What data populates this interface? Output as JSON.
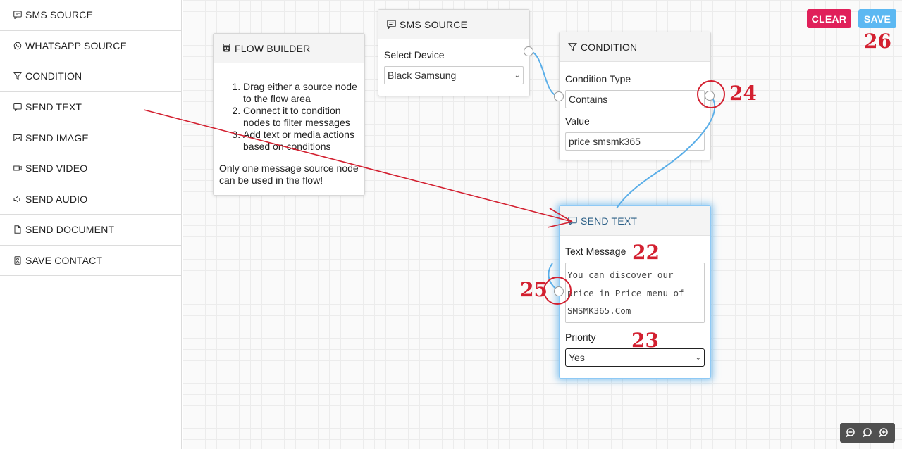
{
  "sidebar": {
    "items": [
      {
        "label": "SMS SOURCE",
        "icon": "chat-icon"
      },
      {
        "label": "WHATSAPP SOURCE",
        "icon": "whatsapp-icon"
      },
      {
        "label": "CONDITION",
        "icon": "filter-icon"
      },
      {
        "label": "SEND TEXT",
        "icon": "message-icon"
      },
      {
        "label": "SEND IMAGE",
        "icon": "image-icon"
      },
      {
        "label": "SEND VIDEO",
        "icon": "video-icon"
      },
      {
        "label": "SEND AUDIO",
        "icon": "speaker-icon"
      },
      {
        "label": "SEND DOCUMENT",
        "icon": "document-icon"
      },
      {
        "label": "SAVE CONTACT",
        "icon": "contact-icon"
      }
    ]
  },
  "toolbar": {
    "clear_label": "CLEAR",
    "save_label": "SAVE",
    "clear_color": "#e0205a",
    "save_color": "#5cb8f2"
  },
  "flow_builder": {
    "title": "FLOW BUILDER",
    "steps": [
      "Drag either a source node to the flow area",
      "Connect it to condition nodes to filter messages",
      "Add text or media actions based on conditions"
    ],
    "note": "Only one message source node can be used in the flow!"
  },
  "sms_source_node": {
    "title": "SMS SOURCE",
    "device_label": "Select Device",
    "device_value": "Black Samsung"
  },
  "condition_node": {
    "title": "CONDITION",
    "type_label": "Condition Type",
    "type_value": "Contains",
    "value_label": "Value",
    "value_value": "price smsmk365"
  },
  "send_text_node": {
    "title": "SEND TEXT",
    "message_label": "Text Message",
    "message_value": "You can discover our price in Price menu of SMSMK365.Com",
    "priority_label": "Priority",
    "priority_value": "Yes"
  },
  "annotations": {
    "a22": "22",
    "a23": "23",
    "a24": "24",
    "a25": "25",
    "a26": "26",
    "color": "#d32030"
  },
  "zoom_controls": [
    "zoom-out-icon",
    "zoom-reset-icon",
    "zoom-in-icon"
  ]
}
